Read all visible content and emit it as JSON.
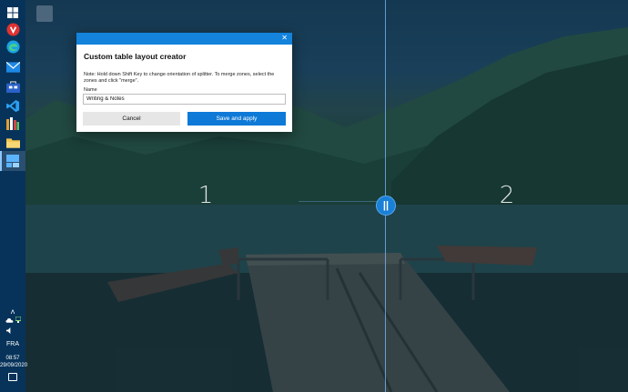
{
  "desktop": {
    "wallpaper": "forest-lake-with-pier"
  },
  "zones": [
    {
      "number": "1"
    },
    {
      "number": "2"
    }
  ],
  "splitter": {
    "handle_glyph": "||",
    "orientation": "vertical"
  },
  "dialog": {
    "title": "Custom table layout creator",
    "close_glyph": "✕",
    "note": "Note: Hold down Shift Key to change orientation of splitter.  To merge zones, select the zones and click \"merge\".",
    "name_label": "Name",
    "name_value": "Writing & Notes",
    "cancel_label": "Cancel",
    "save_label": "Save and apply"
  },
  "taskbar": {
    "apps": [
      "start-icon",
      "vivaldi-icon",
      "edge-icon",
      "mail-icon",
      "store-icon",
      "vscode-icon",
      "books-icon",
      "file-explorer-icon",
      "fancyzones-icon"
    ],
    "tray": {
      "chevron_glyph": "˄",
      "language": "FRA",
      "time": "08:57",
      "date": "29/09/2020"
    }
  },
  "colors": {
    "accent": "#0e79d6",
    "titlebar": "#1383dc",
    "taskbar": "#07335a",
    "zone_overlay": "#00325a"
  }
}
